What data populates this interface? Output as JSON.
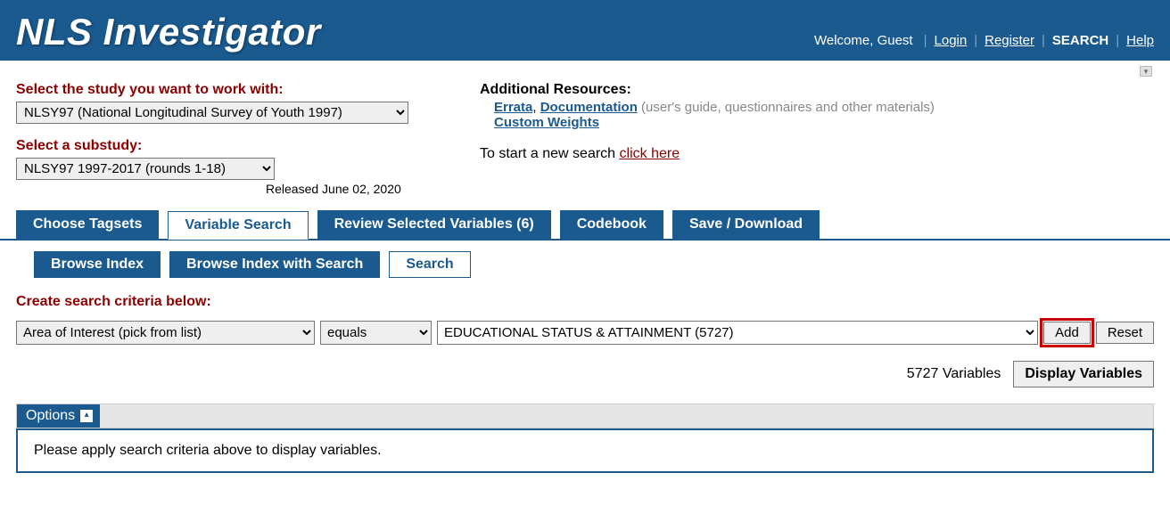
{
  "header": {
    "title": "NLS Investigator",
    "welcome": "Welcome, Guest",
    "links": {
      "login": "Login",
      "register": "Register",
      "search": "SEARCH",
      "help": "Help"
    }
  },
  "study": {
    "label": "Select the study you want to work with:",
    "selected": "NLSY97 (National Longitudinal Survey of Youth 1997)"
  },
  "substudy": {
    "label": "Select a substudy:",
    "selected": "NLSY97 1997-2017 (rounds 1-18)",
    "released": "Released June 02, 2020"
  },
  "resources": {
    "label": "Additional Resources:",
    "errata": "Errata",
    "documentation": "Documentation",
    "documentation_desc": "(user's guide, questionnaires and other materials)",
    "custom_weights": "Custom Weights",
    "start_text": "To start a new search ",
    "start_link": "click here"
  },
  "main_tabs": [
    {
      "label": "Choose Tagsets",
      "active": false
    },
    {
      "label": "Variable Search",
      "active": true
    },
    {
      "label": "Review Selected Variables (6)",
      "active": false
    },
    {
      "label": "Codebook",
      "active": false
    },
    {
      "label": "Save / Download",
      "active": false
    }
  ],
  "sub_tabs": [
    {
      "label": "Browse Index",
      "active": false
    },
    {
      "label": "Browse Index with Search",
      "active": false
    },
    {
      "label": "Search",
      "active": true
    }
  ],
  "criteria": {
    "label": "Create search criteria below:",
    "area_of_interest": "Area of Interest   (pick from list)",
    "operator": "equals",
    "value": "EDUCATIONAL STATUS & ATTAINMENT (5727)",
    "add": "Add",
    "reset": "Reset"
  },
  "results": {
    "count_text": "5727 Variables",
    "display_btn": "Display Variables",
    "options_label": "Options",
    "message": "Please apply search criteria above to display variables."
  }
}
